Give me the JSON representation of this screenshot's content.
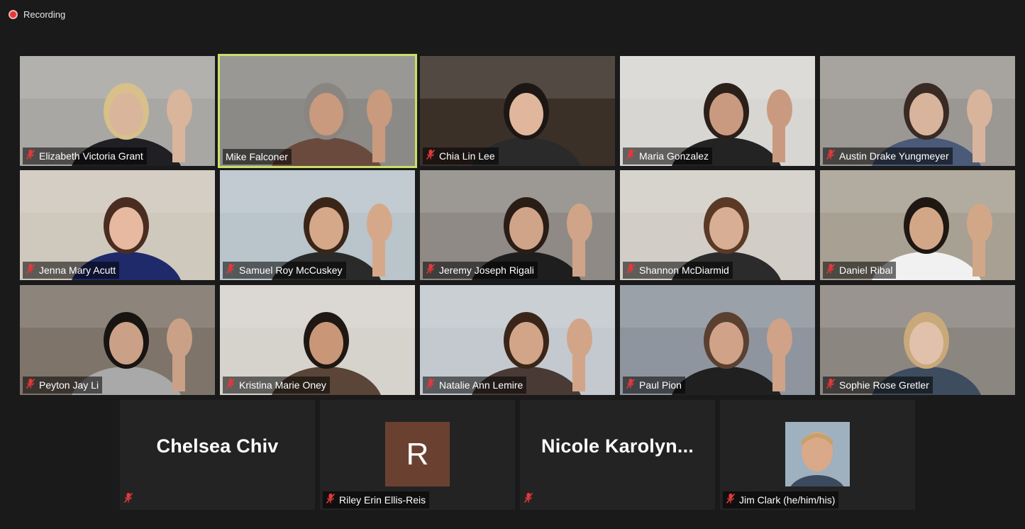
{
  "recording": {
    "label": "Recording"
  },
  "participants": [
    {
      "name": "Elizabeth Victoria Grant",
      "muted": true,
      "bg": "#a9a7a3",
      "skin": "#d9b59c",
      "hair": "#d8c08a",
      "shirt": "#1f1f24"
    },
    {
      "name": "Mike Falconer",
      "muted": false,
      "bg": "#8c8a86",
      "skin": "#c99a7e",
      "hair": "#8a8580",
      "shirt": "#6b4a3e",
      "active": true
    },
    {
      "name": "Chia Lin Lee",
      "muted": true,
      "bg": "#3b3028",
      "skin": "#e0b79c",
      "hair": "#1c1714",
      "shirt": "#2a2a2a"
    },
    {
      "name": "Maria Gonzalez",
      "muted": true,
      "bg": "#d8d6d2",
      "skin": "#c99a80",
      "hair": "#2b1f19",
      "shirt": "#232323"
    },
    {
      "name": "Austin Drake Yungmeyer",
      "muted": true,
      "bg": "#9b9792",
      "skin": "#d8b49c",
      "hair": "#3a2a24",
      "shirt": "#4a5a78"
    },
    {
      "name": "Jenna Mary Acutt",
      "muted": true,
      "bg": "#cfc8bd",
      "skin": "#e6b9a0",
      "hair": "#4a2d20",
      "shirt": "#1f2a6a"
    },
    {
      "name": "Samuel Roy McCuskey",
      "muted": true,
      "bg": "#b9c4cb",
      "skin": "#d6a88a",
      "hair": "#3a2618",
      "shirt": "#2a2a2a"
    },
    {
      "name": "Jeremy Joseph Rigali",
      "muted": true,
      "bg": "#8f8a86",
      "skin": "#d0a488",
      "hair": "#2a1d16",
      "shirt": "#1e1e1e"
    },
    {
      "name": "Shannon McDiarmid",
      "muted": true,
      "bg": "#d2cec7",
      "skin": "#d8ae94",
      "hair": "#5a3a26",
      "shirt": "#2b2b2b"
    },
    {
      "name": "Daniel Ribal",
      "muted": true,
      "bg": "#a8a092",
      "skin": "#d2a788",
      "hair": "#1f1712",
      "shirt": "#f1f1f1"
    },
    {
      "name": "Peyton Jay Li",
      "muted": true,
      "bg": "#7e746a",
      "skin": "#caa187",
      "hair": "#181411",
      "shirt": "#a9a9a9"
    },
    {
      "name": "Kristina Marie Oney",
      "muted": true,
      "bg": "#d6d3cd",
      "skin": "#c99778",
      "hair": "#1e1712",
      "shirt": "#5a4538"
    },
    {
      "name": "Natalie Ann Lemire",
      "muted": true,
      "bg": "#c3c9cf",
      "skin": "#d2a588",
      "hair": "#3a2619",
      "shirt": "#4a3a36"
    },
    {
      "name": "Paul Pion",
      "muted": true,
      "bg": "#8e959e",
      "skin": "#d0a287",
      "hair": "#5a4030",
      "shirt": "#202020"
    },
    {
      "name": "Sophie Rose Gretler",
      "muted": true,
      "bg": "#8b8680",
      "skin": "#e1c1ab",
      "hair": "#c9a97a",
      "shirt": "#3d4c5e"
    }
  ],
  "bottom_row": [
    {
      "display_name": "Chelsea Chiv",
      "muted": true,
      "kind": "name"
    },
    {
      "name": "Riley Erin Ellis-Reis",
      "initial": "R",
      "muted": true,
      "kind": "initial"
    },
    {
      "display_name": "Nicole  Karolyn...",
      "muted": true,
      "kind": "name"
    },
    {
      "name": "Jim Clark (he/him/his)",
      "muted": true,
      "kind": "photo"
    }
  ],
  "colors": {
    "active_border": "#c8e06a",
    "muted_icon": "#e5383b",
    "initial_bg": "#6a4131"
  }
}
